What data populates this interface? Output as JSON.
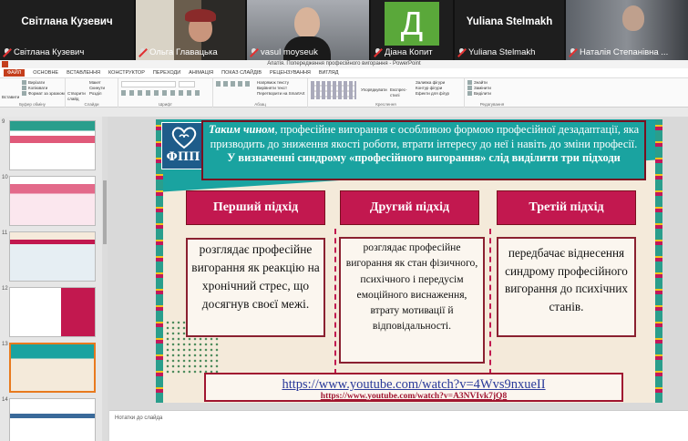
{
  "participants": [
    {
      "name": "Світлана Кузевич",
      "caption": "Світлана Кузевич",
      "type": "name"
    },
    {
      "name": "",
      "caption": "Ольга Главацька",
      "type": "video"
    },
    {
      "name": "",
      "caption": "vasul moyseuk",
      "type": "video"
    },
    {
      "name": "Д",
      "caption": "Діана Копит",
      "type": "avatar"
    },
    {
      "name": "Yuliana Stelmakh",
      "caption": "Yuliana Stelmakh",
      "type": "name"
    },
    {
      "name": "",
      "caption": "Наталія Степанівна ...",
      "type": "video"
    }
  ],
  "ppt": {
    "title": "Апатія. Попередження професійного вигорання - PowerPoint",
    "tabs": [
      "ФАЙЛ",
      "ОСНОВНЕ",
      "ВСТАВЛЕННЯ",
      "КОНСТРУКТОР",
      "ПЕРЕХОДИ",
      "АНІМАЦІЯ",
      "ПОКАЗ СЛАЙДІВ",
      "РЕЦЕНЗУВАННЯ",
      "ВИГЛЯД"
    ],
    "ribbon": {
      "clipboard": {
        "label": "Буфер обміну",
        "items": [
          "Вирізати",
          "Копіювати",
          "Формат за зразком"
        ],
        "paste": "Вставити"
      },
      "slides": {
        "label": "Слайди",
        "items": [
          "Макет",
          "Скинути",
          "Розділ"
        ],
        "new": "Створити слайд"
      },
      "font": {
        "label": "Шрифт"
      },
      "paragraph": {
        "label": "Абзац",
        "items": [
          "Напрямок тексту",
          "Вирівняти текст",
          "Перетворити на SmartArt"
        ]
      },
      "drawing": {
        "label": "Креслення",
        "items": [
          "Упорядкувати",
          "Експрес-стилі",
          "Заливка фігури",
          "Контур фігури",
          "Ефекти для фігур"
        ]
      },
      "editing": {
        "label": "Редагування",
        "items": [
          "Знайти",
          "Замінити",
          "Виділити"
        ]
      }
    },
    "slide_numbers": [
      "9",
      "10",
      "11",
      "12",
      "13",
      "14"
    ],
    "notes_placeholder": "Нотатки до слайда"
  },
  "slide": {
    "logo": "ФПП",
    "intro_em": "Таким чином",
    "intro_1": ", професійне вигорання є особливою формою професійної дезадаптації, яка призводить до зниження якості роботи, втрати інтересу до неї і навіть до зміни професії.",
    "intro_2": "У визначенні синдрому «професійного вигорання» слід виділити три підходи",
    "headers": [
      "Перший підхід",
      "Другий підхід",
      "Третій підхід"
    ],
    "texts": [
      "розглядає професійне вигорання як реакцію на хронічний стрес, що досягнув своєї межі.",
      "розглядає професійне вигорання як стан фізичного, психічного і передусім емоційного виснаження, втрату мотивації й відповідальності.",
      "передбачає віднесення синдрому професійного вигорання до психічних станів."
    ],
    "link_main": "https://www.youtube.com/watch?v=4Wvs9nxueII",
    "link_sub": "https://www.youtube.com/watch?v=A3NVIvk7jQ8"
  }
}
